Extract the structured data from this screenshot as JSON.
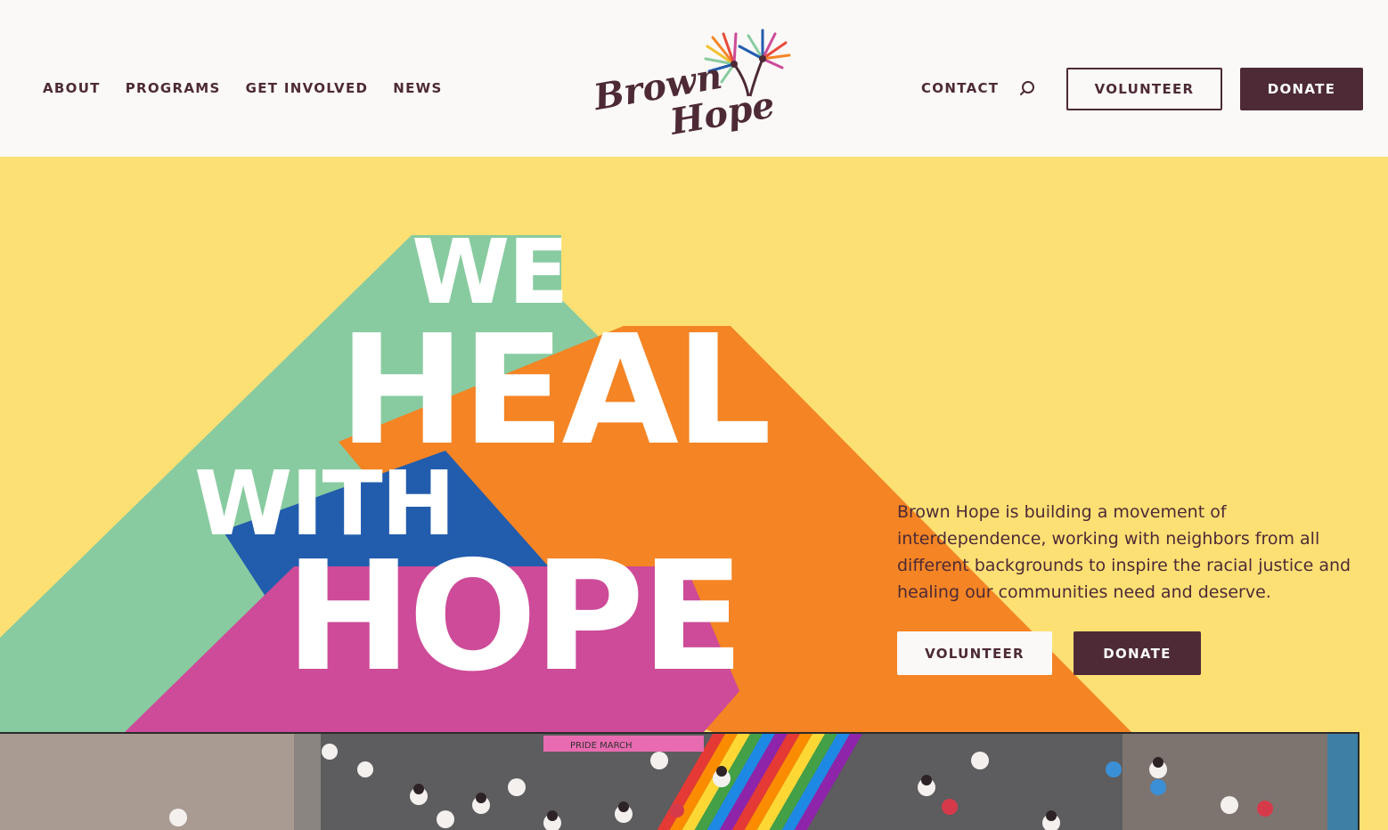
{
  "header": {
    "nav_left": [
      "ABOUT",
      "PROGRAMS",
      "GET INVOLVED",
      "NEWS"
    ],
    "logo_line1": "Brown",
    "logo_line2": "Hope",
    "nav_right": "CONTACT",
    "volunteer_label": "VOLUNTEER",
    "donate_label": "DONATE"
  },
  "hero": {
    "line1": "WE",
    "line2": "HEAL",
    "line3": "WITH",
    "line4": "HOPE",
    "description": "Brown Hope is building a movement of interdependence, working with neighbors from all different backgrounds to inspire the racial justice and healing our communities need and deserve.",
    "volunteer_label": "VOLUNTEER",
    "donate_label": "DONATE"
  },
  "colors": {
    "brand_dark": "#4d2a36",
    "hero_yellow": "#fde074",
    "green": "#88cba0",
    "orange": "#f48424",
    "blue": "#225cad",
    "pink": "#cd4b98"
  },
  "icons": {
    "search": "search-icon",
    "logo_burst": "firework-burst-icon"
  },
  "photo": {
    "label": "PRIDE MARCH"
  }
}
